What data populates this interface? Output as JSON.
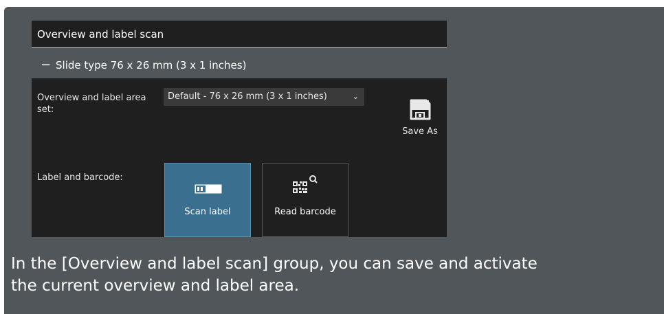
{
  "group": {
    "title": "Overview and label scan",
    "subsection_toggle": "−",
    "subsection_title": "Slide type 76 x 26 mm (3 x 1 inches)"
  },
  "area_set": {
    "label": "Overview and label area set:",
    "selected_value": "Default - 76 x 26 mm (3 x 1 inches)",
    "save_as_label": "Save As"
  },
  "label_barcode": {
    "label": "Label and barcode:",
    "scan_label": "Scan label",
    "read_barcode": "Read barcode"
  },
  "caption": {
    "line1": "In the [Overview and label scan] group, you can save and activate",
    "line2": "the current overview and label area."
  },
  "colors": {
    "panel_bg": "#505659",
    "header_bg": "#1f1f1f",
    "active_button": "#3a6f8f"
  }
}
